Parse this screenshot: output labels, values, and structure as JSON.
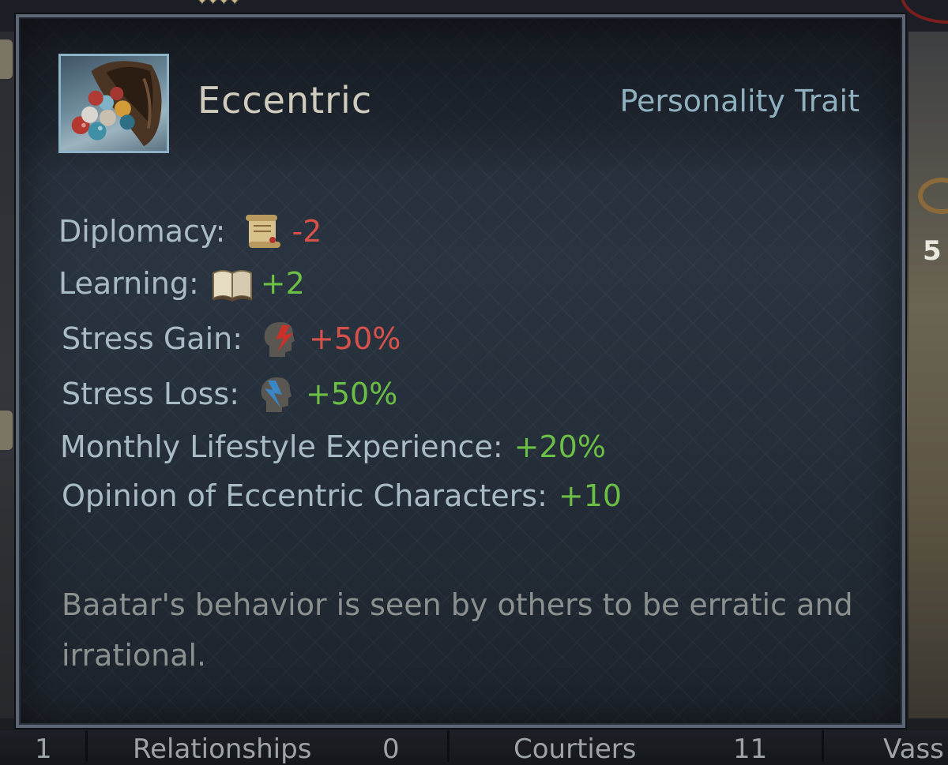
{
  "background": {
    "right_number_partial": "5",
    "top_stars": "✦✦✦✦"
  },
  "tooltip": {
    "icon": "trait-eccentric-icon",
    "title": "Eccentric",
    "category": "Personality Trait",
    "stats": [
      {
        "label": "Diplomacy:",
        "icon": "diplomacy-scroll-icon",
        "value": "-2",
        "tone": "negative"
      },
      {
        "label": "Learning:",
        "icon": "learning-book-icon",
        "value": "+2",
        "tone": "positive"
      },
      {
        "label": "Stress Gain:",
        "icon": "stress-gain-icon",
        "value": "+50%",
        "tone": "negative"
      },
      {
        "label": "Stress Loss:",
        "icon": "stress-loss-icon",
        "value": "+50%",
        "tone": "positive"
      },
      {
        "label": "Monthly Lifestyle Experience:",
        "value": "+20%",
        "tone": "positive"
      },
      {
        "label": "Opinion of Eccentric Characters:",
        "value": "+10",
        "tone": "positive"
      }
    ],
    "flavor_text": "Baatar's behavior is seen by others to be erratic and irrational.",
    "colors": {
      "negative": "#d9524a",
      "positive": "#6cbf45",
      "border": "#5c6675"
    }
  },
  "bottom_tabs": {
    "first_count": "1",
    "relationships_label": "Relationships",
    "relationships_count": "0",
    "courtiers_label": "Courtiers",
    "courtiers_count": "11",
    "vassals_label_partial": "Vass"
  }
}
